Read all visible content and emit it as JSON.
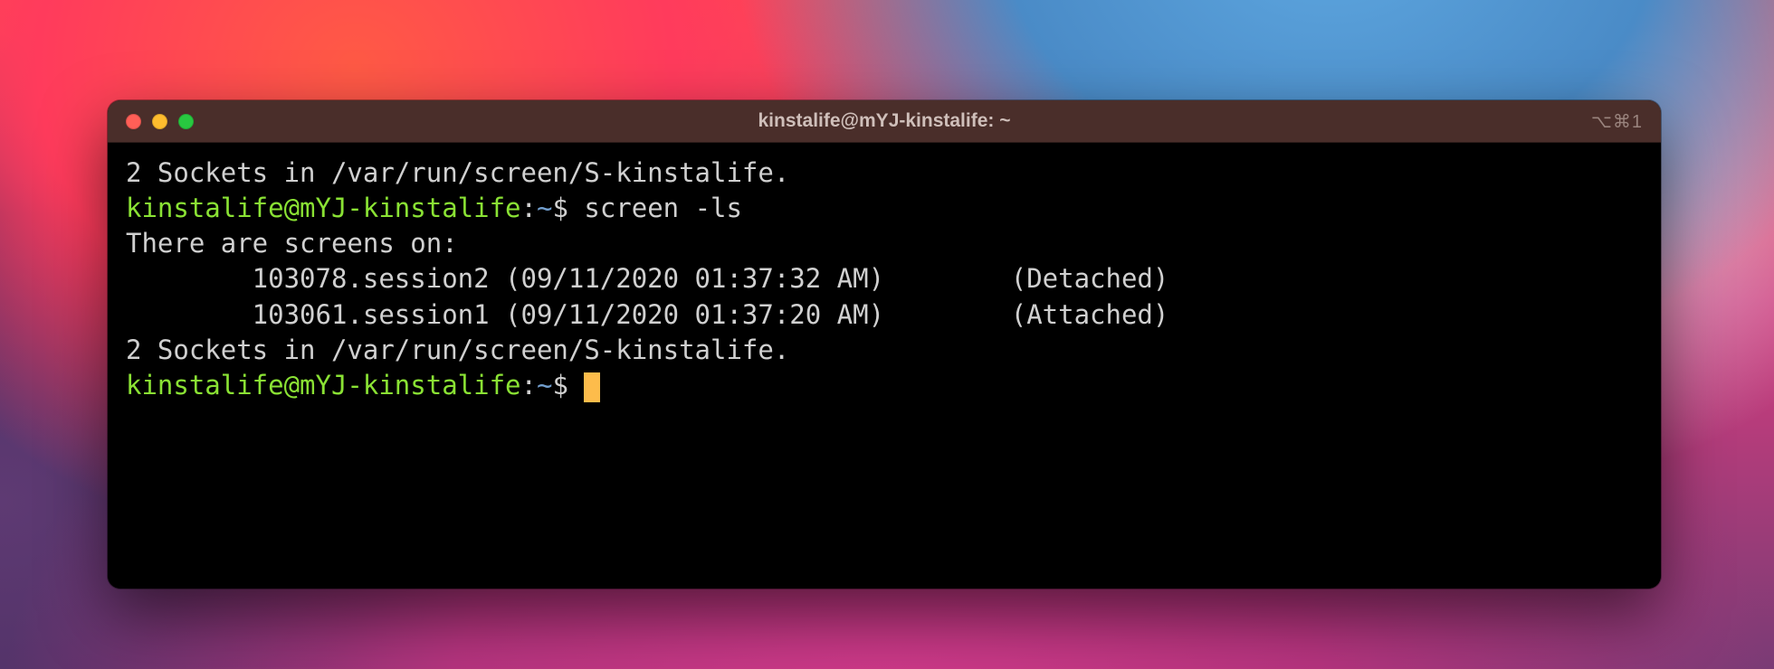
{
  "window": {
    "title": "kinstalife@mYJ-kinstalife: ~",
    "right_indicator": "⌥⌘1"
  },
  "prompt": {
    "userhost": "kinstalife@mYJ-kinstalife",
    "sep": ":",
    "path": "~",
    "symbol": "$"
  },
  "lines": {
    "sockets_line_1": "2 Sockets in /var/run/screen/S-kinstalife.",
    "command_1": " screen -ls",
    "screens_on": "There are screens on:",
    "session_1": "        103078.session2 (09/11/2020 01:37:32 AM)        (Detached)",
    "session_2": "        103061.session1 (09/11/2020 01:37:20 AM)        (Attached)",
    "sockets_line_2": "2 Sockets in /var/run/screen/S-kinstalife."
  }
}
